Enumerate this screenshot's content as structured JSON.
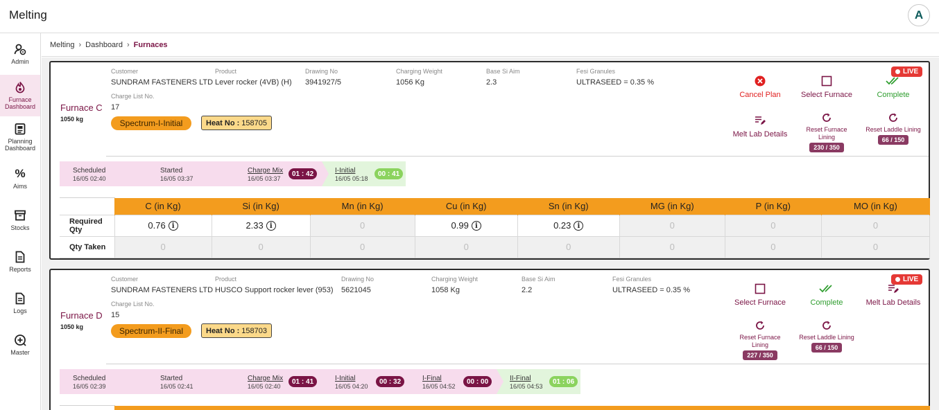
{
  "app": {
    "title": "Melting",
    "avatar_letter": "A"
  },
  "sidebar": {
    "items": [
      {
        "label": "Admin",
        "icon": "admin-icon",
        "active": false
      },
      {
        "label": "Furnace Dashboard",
        "icon": "furnace-icon",
        "active": true
      },
      {
        "label": "Planning Dashboard",
        "icon": "planning-icon",
        "active": false
      },
      {
        "label": "Aims",
        "icon": "percent-icon",
        "active": false
      },
      {
        "label": "Stocks",
        "icon": "stocks-icon",
        "active": false
      },
      {
        "label": "Reports",
        "icon": "reports-icon",
        "active": false
      },
      {
        "label": "Logs",
        "icon": "logs-icon",
        "active": false
      },
      {
        "label": "Master",
        "icon": "master-icon",
        "active": false
      }
    ]
  },
  "breadcrumb": {
    "items": [
      "Melting",
      "Dashboard",
      "Furnaces"
    ]
  },
  "labels": {
    "customer": "Customer",
    "product": "Product",
    "drawing_no": "Drawing No",
    "charging_weight": "Charging Weight",
    "base_si_aim": "Base Si Aim",
    "fesi_granules": "Fesi Granules",
    "charge_list_no": "Charge List No.",
    "heat_no": "Heat No :",
    "live": "LIVE",
    "required_qty": "Required Qty",
    "qty_taken": "Qty Taken"
  },
  "elements": [
    "C (in Kg)",
    "Si (in Kg)",
    "Mn (in Kg)",
    "Cu (in Kg)",
    "Sn (in Kg)",
    "MG (in Kg)",
    "P (in Kg)",
    "MO (in Kg)"
  ],
  "furnaces": [
    {
      "name": "Furnace C",
      "capacity": "1050 kg",
      "customer": "SUNDRAM FASTENERS LTD",
      "product": "Lever rocker (4VB) (H)",
      "drawing_no": "3941927/5",
      "charging_weight": "1056 Kg",
      "base_si_aim": "2.3",
      "fesi_granules": "ULTRASEED = 0.35 %",
      "charge_list_no": "17",
      "spectrum": "Spectrum-I-Initial",
      "heat_no": "158705",
      "actions": {
        "cancel_plan": "Cancel Plan",
        "select_furnace": "Select Furnace",
        "complete": "Complete",
        "melt_lab_details": "Melt Lab Details",
        "reset_furnace_lining": "Reset Furnace Lining",
        "reset_furnace_count": "230 / 350",
        "reset_laddle_lining": "Reset Laddle Lining",
        "reset_laddle_count": "66 / 150"
      },
      "stages": [
        {
          "name": "Scheduled",
          "time": "16/05 02:40",
          "timer": ""
        },
        {
          "name": "Started",
          "time": "16/05 03:37",
          "timer": ""
        },
        {
          "name": "Charge Mix",
          "time": "16/05 03:37",
          "timer": "01 : 42"
        },
        {
          "name": "I-Initial",
          "time": "16/05 05:18",
          "timer": "00 : 41"
        }
      ],
      "required_qty": [
        "0.76",
        "2.33",
        "0",
        "0.99",
        "0.23",
        "0",
        "0",
        "0"
      ],
      "qty_taken": [
        "0",
        "0",
        "0",
        "0",
        "0",
        "0",
        "0",
        "0"
      ]
    },
    {
      "name": "Furnace D",
      "capacity": "1050 kg",
      "customer": "SUNDRAM FASTENERS LTD",
      "product": "HUSCO Support rocker lever (953)",
      "drawing_no": "5621045",
      "charging_weight": "1058 Kg",
      "base_si_aim": "2.2",
      "fesi_granules": "ULTRASEED = 0.35 %",
      "charge_list_no": "15",
      "spectrum": "Spectrum-II-Final",
      "heat_no": "158703",
      "actions": {
        "select_furnace": "Select Furnace",
        "complete": "Complete",
        "melt_lab_details": "Melt Lab Details",
        "reset_furnace_lining": "Reset Furnace Lining",
        "reset_furnace_count": "227 / 350",
        "reset_laddle_lining": "Reset Laddle Lining",
        "reset_laddle_count": "66 / 150"
      },
      "stages": [
        {
          "name": "Scheduled",
          "time": "16/05 02:39",
          "timer": ""
        },
        {
          "name": "Started",
          "time": "16/05 02:41",
          "timer": ""
        },
        {
          "name": "Charge Mix",
          "time": "16/05 02:40",
          "timer": "01 : 41"
        },
        {
          "name": "I-Initial",
          "time": "16/05 04:20",
          "timer": "00 : 32"
        },
        {
          "name": "I-Final",
          "time": "16/05 04:52",
          "timer": "00 : 00"
        },
        {
          "name": "II-Final",
          "time": "16/05 04:53",
          "timer": "01 : 06"
        }
      ]
    }
  ],
  "colors": {
    "brand": "#7a1445",
    "accent_orange": "#f39c1e",
    "live_red": "#e53935",
    "complete_green": "#2e9d2e",
    "stage_pink": "#f7dced",
    "stage_green": "#e2f5dc"
  }
}
